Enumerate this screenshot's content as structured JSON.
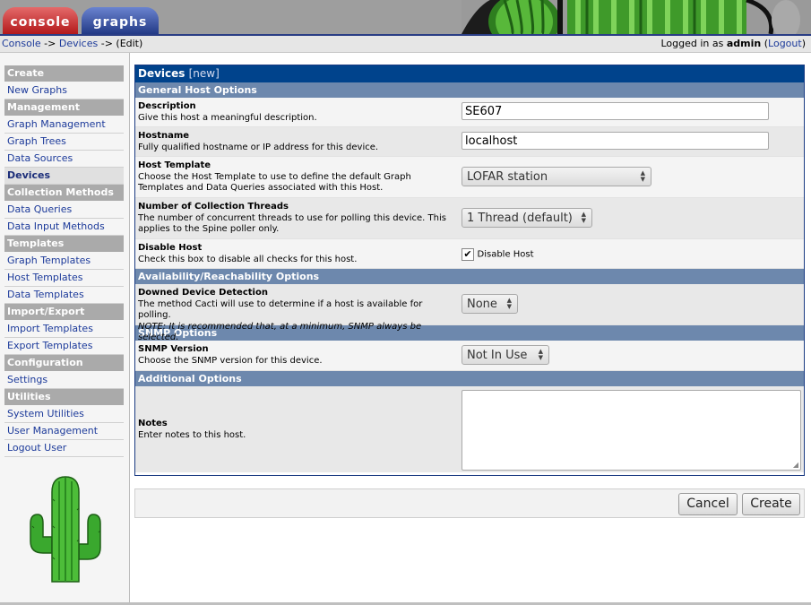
{
  "tabs": {
    "console": "console",
    "graphs": "graphs"
  },
  "breadcrumb": {
    "console": "Console",
    "sep1": "->",
    "devices": "Devices",
    "sep2": "->",
    "edit": "(Edit)"
  },
  "login": {
    "prefix": "Logged in as",
    "user": "admin",
    "logout": "Logout"
  },
  "sidebar": {
    "create": "Create",
    "new_graphs": "New Graphs",
    "management": "Management",
    "graph_management": "Graph Management",
    "graph_trees": "Graph Trees",
    "data_sources": "Data Sources",
    "devices": "Devices",
    "collection_methods": "Collection Methods",
    "data_queries": "Data Queries",
    "data_input_methods": "Data Input Methods",
    "templates": "Templates",
    "graph_templates": "Graph Templates",
    "host_templates": "Host Templates",
    "data_templates": "Data Templates",
    "import_export": "Import/Export",
    "import_templates": "Import Templates",
    "export_templates": "Export Templates",
    "configuration": "Configuration",
    "settings": "Settings",
    "utilities": "Utilities",
    "system_utilities": "System Utilities",
    "user_management": "User Management",
    "logout_user": "Logout User"
  },
  "form": {
    "title": "Devices",
    "title_suffix": "[new]",
    "general_header": "General Host Options",
    "description": {
      "label": "Description",
      "help": "Give this host a meaningful description.",
      "value": "SE607"
    },
    "hostname": {
      "label": "Hostname",
      "help": "Fully qualified hostname or IP address for this device.",
      "value": "localhost"
    },
    "host_template": {
      "label": "Host Template",
      "help": "Choose the Host Template to use to define the default Graph Templates and Data Queries associated with this Host.",
      "value": "LOFAR station"
    },
    "threads": {
      "label": "Number of Collection Threads",
      "help": "The number of concurrent threads to use for polling this device. This applies to the Spine poller only.",
      "value": "1 Thread (default)"
    },
    "disable": {
      "label": "Disable Host",
      "help": "Check this box to disable all checks for this host.",
      "checkbox_label": "Disable Host",
      "checked": true
    },
    "availability_header": "Availability/Reachability Options",
    "downed": {
      "label": "Downed Device Detection",
      "help": "The method Cacti will use to determine if a host is available for polling.",
      "note": "NOTE: It is recommended that, at a minimum, SNMP always be selected.",
      "value": "None"
    },
    "snmp_header": "SNMP Options",
    "snmp_version": {
      "label": "SNMP Version",
      "help": "Choose the SNMP version for this device.",
      "value": "Not In Use"
    },
    "additional_header": "Additional Options",
    "notes": {
      "label": "Notes",
      "help": "Enter notes to this host.",
      "value": ""
    }
  },
  "buttons": {
    "cancel": "Cancel",
    "create": "Create"
  },
  "colors": {
    "title_bar": "#00438c",
    "section": "#6d88ad",
    "link": "#1c3a9a",
    "console_tab": "#b3191b",
    "graphs_tab": "#233a86"
  }
}
